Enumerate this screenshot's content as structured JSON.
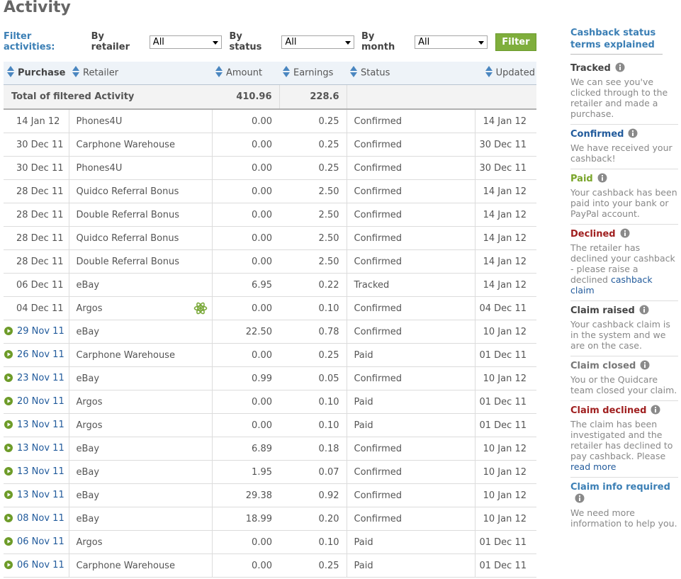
{
  "page": {
    "title": "Activity"
  },
  "filter": {
    "title": "Filter activities:",
    "retailer_label": "By retailer",
    "retailer_value": "All",
    "status_label": "By status",
    "status_value": "All",
    "month_label": "By month",
    "month_value": "All",
    "button_label": "Filter"
  },
  "table": {
    "headers": {
      "purchase": "Purchase",
      "retailer": "Retailer",
      "amount": "Amount",
      "earnings": "Earnings",
      "status": "Status",
      "updated": "Updated"
    },
    "total": {
      "label": "Total of filtered Activity",
      "amount": "410.96",
      "earnings": "228.6"
    },
    "rows": [
      {
        "date": "14 Jan 12",
        "retailer": "Phones4U",
        "amount": "0.00",
        "earnings": "0.25",
        "status": "Confirmed",
        "updated": "14 Jan 12"
      },
      {
        "date": "30 Dec 11",
        "retailer": "Carphone Warehouse",
        "amount": "0.00",
        "earnings": "0.25",
        "status": "Confirmed",
        "updated": "30 Dec 11"
      },
      {
        "date": "30 Dec 11",
        "retailer": "Phones4U",
        "amount": "0.00",
        "earnings": "0.25",
        "status": "Confirmed",
        "updated": "30 Dec 11"
      },
      {
        "date": "28 Dec 11",
        "retailer": "Quidco Referral Bonus",
        "amount": "0.00",
        "earnings": "2.50",
        "status": "Confirmed",
        "updated": "14 Jan 12"
      },
      {
        "date": "28 Dec 11",
        "retailer": "Double Referral Bonus",
        "amount": "0.00",
        "earnings": "2.50",
        "status": "Confirmed",
        "updated": "14 Jan 12"
      },
      {
        "date": "28 Dec 11",
        "retailer": "Quidco Referral Bonus",
        "amount": "0.00",
        "earnings": "2.50",
        "status": "Confirmed",
        "updated": "14 Jan 12"
      },
      {
        "date": "28 Dec 11",
        "retailer": "Double Referral Bonus",
        "amount": "0.00",
        "earnings": "2.50",
        "status": "Confirmed",
        "updated": "14 Jan 12"
      },
      {
        "date": "06 Dec 11",
        "retailer": "eBay",
        "amount": "6.95",
        "earnings": "0.22",
        "status": "Tracked",
        "updated": "14 Jan 12"
      },
      {
        "date": "04 Dec 11",
        "retailer": "Argos",
        "amount": "0.00",
        "earnings": "0.10",
        "status": "Confirmed",
        "updated": "04 Dec 11"
      },
      {
        "date": "29 Nov 11",
        "retailer": "eBay",
        "amount": "22.50",
        "earnings": "0.78",
        "status": "Confirmed",
        "updated": "10 Jan 12"
      },
      {
        "date": "26 Nov 11",
        "retailer": "Carphone Warehouse",
        "amount": "0.00",
        "earnings": "0.25",
        "status": "Paid",
        "updated": "01 Dec 11"
      },
      {
        "date": "23 Nov 11",
        "retailer": "eBay",
        "amount": "0.99",
        "earnings": "0.05",
        "status": "Confirmed",
        "updated": "10 Jan 12"
      },
      {
        "date": "20 Nov 11",
        "retailer": "Argos",
        "amount": "0.00",
        "earnings": "0.10",
        "status": "Paid",
        "updated": "01 Dec 11"
      },
      {
        "date": "13 Nov 11",
        "retailer": "Argos",
        "amount": "0.00",
        "earnings": "0.10",
        "status": "Paid",
        "updated": "01 Dec 11"
      },
      {
        "date": "13 Nov 11",
        "retailer": "eBay",
        "amount": "6.89",
        "earnings": "0.18",
        "status": "Confirmed",
        "updated": "10 Jan 12"
      },
      {
        "date": "13 Nov 11",
        "retailer": "eBay",
        "amount": "1.95",
        "earnings": "0.07",
        "status": "Confirmed",
        "updated": "10 Jan 12"
      },
      {
        "date": "13 Nov 11",
        "retailer": "eBay",
        "amount": "29.38",
        "earnings": "0.92",
        "status": "Confirmed",
        "updated": "10 Jan 12"
      },
      {
        "date": "08 Nov 11",
        "retailer": "eBay",
        "amount": "18.99",
        "earnings": "0.20",
        "status": "Confirmed",
        "updated": "10 Jan 12"
      },
      {
        "date": "06 Nov 11",
        "retailer": "Argos",
        "amount": "0.00",
        "earnings": "0.10",
        "status": "Paid",
        "updated": "01 Dec 11"
      },
      {
        "date": "06 Nov 11",
        "retailer": "Carphone Warehouse",
        "amount": "0.00",
        "earnings": "0.25",
        "status": "Paid",
        "updated": "01 Dec 11"
      }
    ]
  },
  "sidebar": {
    "title": "Cashback status terms explained",
    "terms": [
      {
        "title": "Tracked",
        "desc": "We can see you've clicked through to the retailer and made a purchase."
      },
      {
        "title": "Confirmed",
        "desc": "We have received your cashback!"
      },
      {
        "title": "Paid",
        "desc": "Your cashback has been paid into your bank or PayPal account."
      },
      {
        "title": "Declined",
        "desc": "The retailer has declined your cashback - please raise a declined",
        "link": "cashback claim"
      },
      {
        "title": "Claim raised",
        "desc": "Your cashback claim is in the system and we are on the case."
      },
      {
        "title": "Claim closed",
        "desc": "You or the Quidcare team closed your claim."
      },
      {
        "title": "Claim declined",
        "desc": "The claim has been investigated and the retailer has declined to pay cashback. Please",
        "link": "read more"
      },
      {
        "title": "Claim info required",
        "desc": "We need more information to help you."
      }
    ]
  },
  "colors": {
    "accent_blue": "#3b7fb5",
    "link_blue": "#225b9c",
    "paid_green": "#79a52a",
    "declined_red": "#a02020",
    "filter_button_green": "#7fae3c"
  },
  "icons": {
    "sort": "sort-up-down-icon",
    "row_expand": "play-circle-icon",
    "info": "info-circle-icon",
    "special_offer": "atom-icon"
  }
}
